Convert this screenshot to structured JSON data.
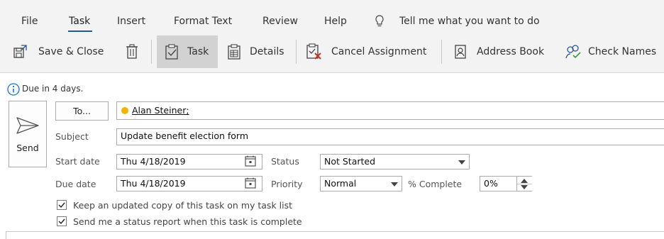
{
  "ribbon": {
    "tabs": [
      "File",
      "Task",
      "Insert",
      "Format Text",
      "Review",
      "Help"
    ],
    "tell_me": "Tell me what you want to do",
    "buttons": {
      "save_close": "Save & Close",
      "task": "Task",
      "details": "Details",
      "cancel_assignment": "Cancel Assignment",
      "address_book": "Address Book",
      "check_names": "Check Names"
    }
  },
  "info_bar": "Due in 4 days.",
  "send": {
    "label": "Send"
  },
  "to": {
    "button": "To...",
    "recipient": "Alan Steiner;"
  },
  "subject": {
    "label": "Subject",
    "value": "Update benefit election form"
  },
  "start_date": {
    "label": "Start date",
    "value": "Thu 4/18/2019"
  },
  "due_date": {
    "label": "Due date",
    "value": "Thu 4/18/2019"
  },
  "status": {
    "label": "Status",
    "value": "Not Started"
  },
  "priority": {
    "label": "Priority",
    "value": "Normal"
  },
  "percent_complete": {
    "label": "% Complete",
    "value": "0%"
  },
  "options": {
    "keep_copy": "Keep an updated copy of this task on my task list",
    "status_report": "Send me a status report when this task is complete"
  },
  "colors": {
    "accent": "#2b579a",
    "info": "#1e73c8",
    "presence": "#f0b400",
    "cancel": "#c0392b"
  }
}
